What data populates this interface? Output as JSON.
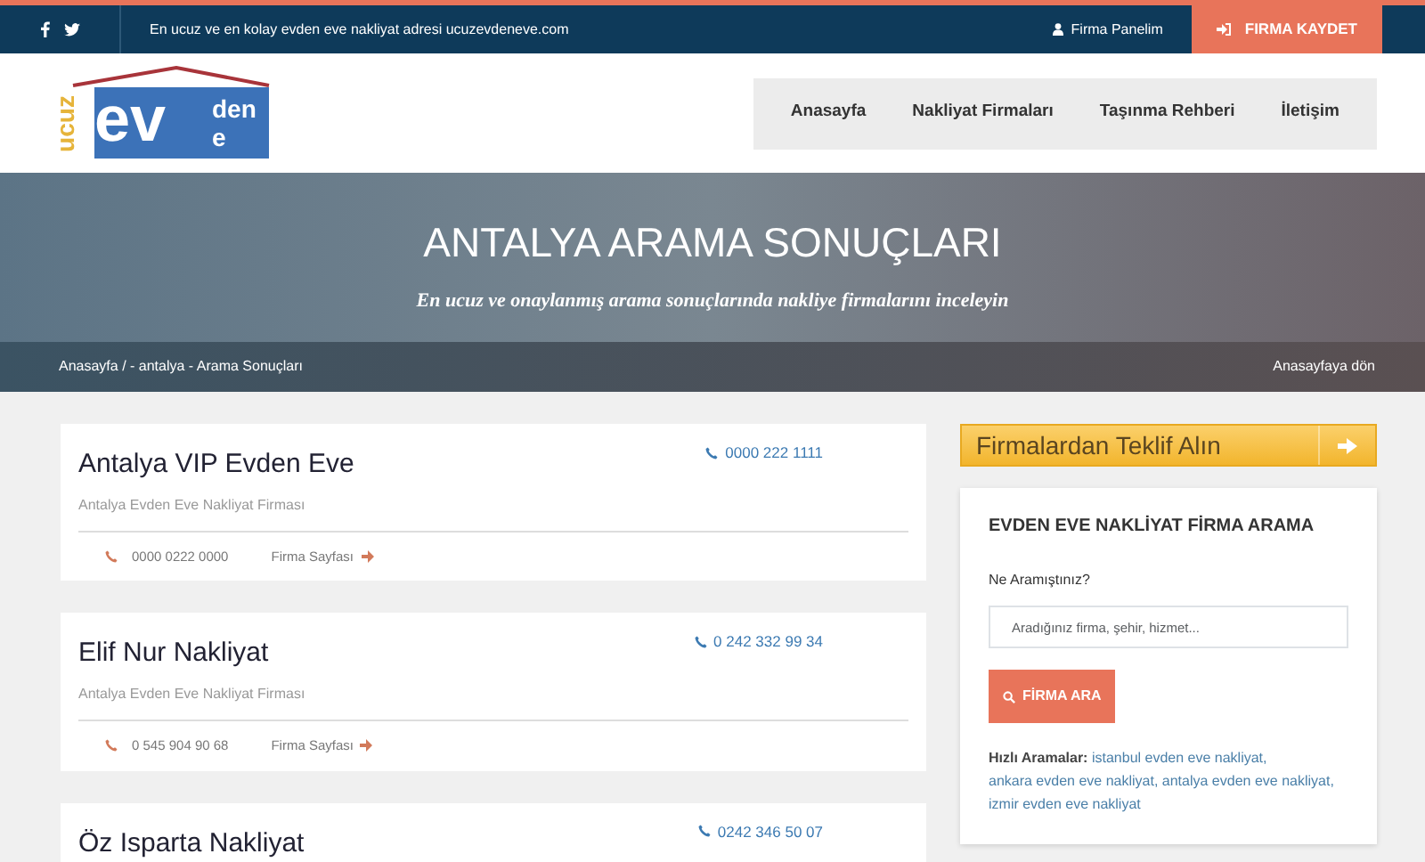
{
  "topbar": {
    "social": [
      {
        "kind": "facebook"
      },
      {
        "kind": "twitter"
      }
    ],
    "tagline": "En ucuz ve en kolay evden eve nakliyat adresi ucuzevdeneve.com",
    "panel_link": "Firma Panelim",
    "register_button": "FIRMA KAYDET"
  },
  "logo": {
    "side": "ucuz",
    "main": "ev",
    "top": "den",
    "bottom": "e"
  },
  "nav": [
    {
      "label": "Anasayfa"
    },
    {
      "label": "Nakliyat Firmaları"
    },
    {
      "label": "Taşınma Rehberi"
    },
    {
      "label": "İletişim"
    }
  ],
  "hero": {
    "title": "ANTALYA ARAMA SONUÇLARI",
    "subtitle": "En ucuz ve onaylanmış arama sonuçlarında nakliye firmalarını inceleyin"
  },
  "breadcrumb": {
    "path": "Anasayfa / - antalya - Arama Sonuçları",
    "back_link": "Anasayfaya dön"
  },
  "results": [
    {
      "name": "Antalya VIP Evden Eve",
      "phone": "0000 222 1111",
      "subtitle": "Antalya Evden Eve Nakliyat Firması",
      "phone_2": "0000 0222 0000",
      "page_link": "Firma Sayfası"
    },
    {
      "name": "Elif Nur Nakliyat",
      "phone": "0 242 332 99 34",
      "subtitle": "Antalya Evden Eve Nakliyat Firması",
      "phone_2": "0 545 904 90 68",
      "page_link": "Firma Sayfası"
    },
    {
      "name": "Öz Isparta Nakliyat",
      "phone": "0242 346 50 07"
    }
  ],
  "offer_banner": {
    "label": "Firmalardan Teklif Alın"
  },
  "search_panel": {
    "title": "EVDEN EVE NAKLİYAT FİRMA ARAMA",
    "field_label": "Ne Aramıştınız?",
    "placeholder": "Aradığınız firma, şehir, hizmet...",
    "button": "FİRMA ARA",
    "quick_label": "Hızlı Aramalar:",
    "quick_links": [
      "istanbul evden eve nakliyat,",
      "ankara evden eve nakliyat,",
      "antalya evden eve nakliyat,",
      "izmir evden eve nakliyat"
    ]
  }
}
